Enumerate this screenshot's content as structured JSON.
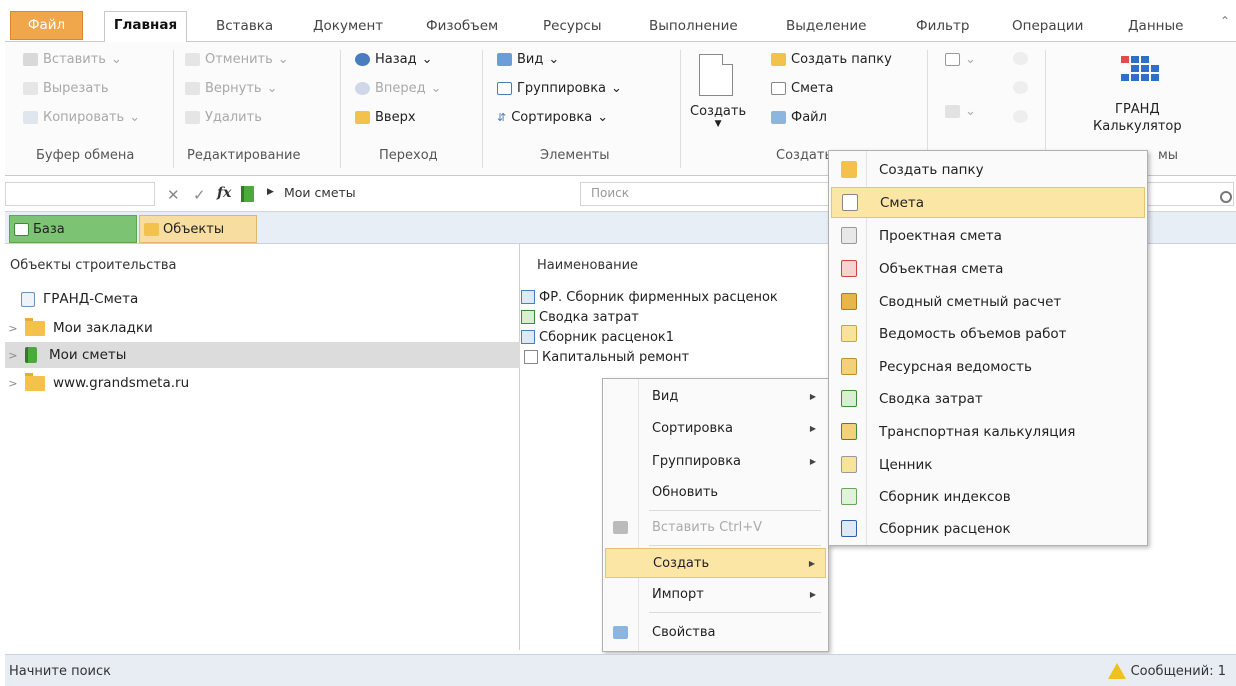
{
  "ribbon_tabs": [
    "Файл",
    "Главная",
    "Вставка",
    "Документ",
    "Физобъем",
    "Ресурсы",
    "Выполнение",
    "Выделение",
    "Фильтр",
    "Операции",
    "Данные"
  ],
  "clipboard": {
    "paste": "Вставить",
    "cut": "Вырезать",
    "copy": "Копировать",
    "label": "Буфер обмена"
  },
  "editing": {
    "undo": "Отменить",
    "redo": "Вернуть",
    "delete": "Удалить",
    "label": "Редактирование"
  },
  "navigation": {
    "back": "Назад",
    "forward": "Вперед",
    "up": "Вверх",
    "label": "Переход"
  },
  "elements": {
    "view": "Вид",
    "group": "Группировка",
    "sort": "Сортировка",
    "label": "Элементы"
  },
  "create": {
    "create": "Создать",
    "new_folder": "Создать папку",
    "estimate": "Смета",
    "file": "Файл",
    "label": "Создать"
  },
  "tools": {
    "grand_line1": "ГРАНД",
    "grand_line2": "Калькулятор",
    "label_partial": "мы"
  },
  "address": {
    "path": "Мои сметы",
    "search_placeholder": "Поиск"
  },
  "db_tabs": {
    "base": "База",
    "objects": "Объекты"
  },
  "left_pane": {
    "title": "Объекты строительства",
    "items": [
      {
        "label": "ГРАНД-Смета"
      },
      {
        "label": "Мои закладки"
      },
      {
        "label": "Мои сметы"
      },
      {
        "label": "www.grandsmeta.ru"
      }
    ]
  },
  "right_pane": {
    "column": "Наименование",
    "items": [
      "ФР. Сборник фирменных расценок",
      "Сводка затрат",
      "Сборник расценок1",
      "Капитальный ремонт"
    ]
  },
  "context_menu": {
    "view": "Вид",
    "sort": "Сортировка",
    "group": "Группировка",
    "refresh": "Обновить",
    "paste": "Вставить  Ctrl+V",
    "create": "Создать",
    "import": "Импорт",
    "properties": "Свойства"
  },
  "create_submenu": [
    "Создать папку",
    "Смета",
    "Проектная смета",
    "Объектная смета",
    "Сводный сметный расчет",
    "Ведомость объемов работ",
    "Ресурсная ведомость",
    "Сводка затрат",
    "Транспортная калькуляция",
    "Ценник",
    "Сборник индексов",
    "Сборник расценок"
  ],
  "status": {
    "left": "Начните поиск",
    "messages": "Сообщений: 1"
  },
  "colors": {
    "accent_orange": "#f0a64a",
    "highlight": "#fbe6a6",
    "base_tab": "#7cc474",
    "objects_tab": "#f8dda0"
  }
}
